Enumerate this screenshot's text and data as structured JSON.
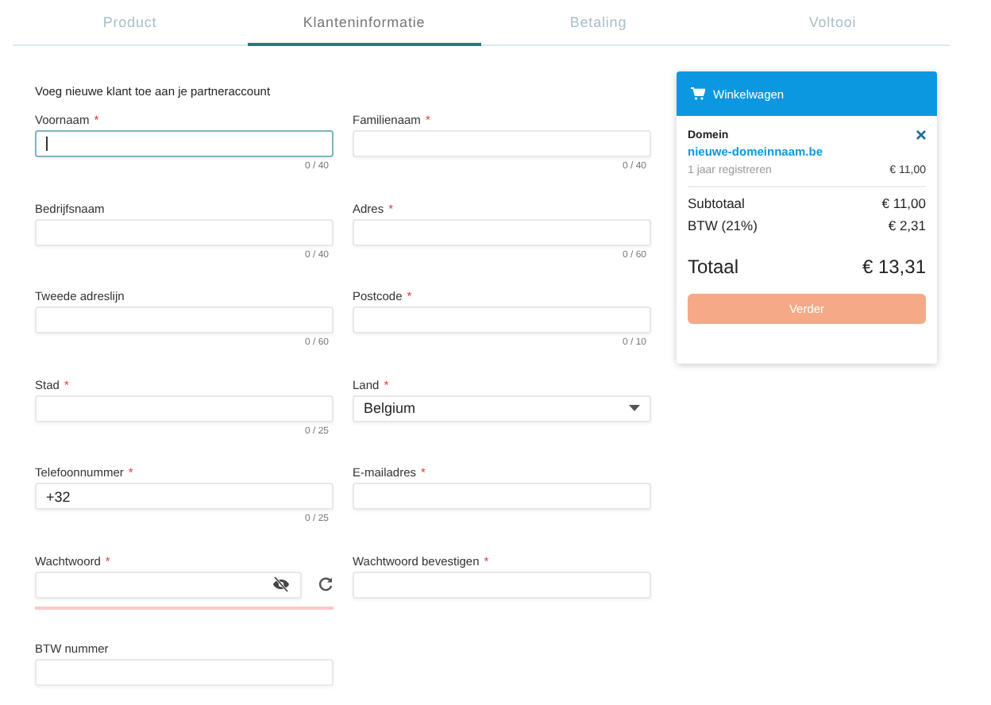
{
  "tabs": [
    {
      "label": "Product",
      "selected": false
    },
    {
      "label": "Klanteninformatie",
      "selected": true
    },
    {
      "label": "Betaling",
      "selected": false
    },
    {
      "label": "Voltooi",
      "selected": false
    }
  ],
  "form": {
    "intro": "Voeg nieuwe klant toe aan je partneraccount",
    "fields": [
      {
        "kind": "text",
        "label": "Voornaam",
        "required_mark": "*",
        "counter": "0 / 40",
        "focused": true
      },
      {
        "kind": "text",
        "label": "Familienaam",
        "required_mark": "*",
        "counter": "0 / 40",
        "focused": false
      },
      {
        "kind": "text",
        "label": "Bedrijfsnaam",
        "counter": "0 / 40",
        "focused": false
      },
      {
        "kind": "text",
        "label": "Adres",
        "required_mark": "*",
        "counter": "0 / 60",
        "focused": false
      },
      {
        "kind": "text",
        "label": "Tweede adreslijn",
        "counter": "0 / 60",
        "focused": false
      },
      {
        "kind": "text",
        "label": "Postcode",
        "required_mark": "*",
        "counter": "0 / 10",
        "focused": false
      },
      {
        "kind": "text",
        "label": "Stad",
        "required_mark": "*",
        "counter": "0 / 25",
        "focused": false
      },
      {
        "kind": "select",
        "label": "Land",
        "required_mark": "*",
        "value": "Belgium",
        "focused": false
      },
      {
        "kind": "text",
        "label": "Telefoonnummer",
        "required_mark": "*",
        "value": "+32",
        "counter": "0 / 25",
        "focused": false
      },
      {
        "kind": "text",
        "label": "E-mailadres",
        "required_mark": "*",
        "focused": false
      },
      {
        "kind": "password",
        "label": "Wachtwoord",
        "required_mark": "*",
        "focused": false,
        "level": 0
      },
      {
        "kind": "text",
        "label": "Wachtwoord bevestigen",
        "required_mark": "*",
        "focused": false
      },
      {
        "kind": "text",
        "label": "BTW nummer",
        "focused": false
      }
    ]
  },
  "cart": {
    "title": "Winkelwagen",
    "item": {
      "type": "Domein",
      "name": "nieuwe-domeinnaam.be",
      "period": "1 jaar registreren",
      "price": "€ 11,00"
    },
    "subtotal": {
      "label": "Subtotaal",
      "value": "€ 11,00"
    },
    "vat": {
      "label": "BTW (21%)",
      "value": "€ 2,31"
    },
    "total": {
      "label": "Totaal",
      "value": "€ 13,31"
    },
    "button": "Verder"
  }
}
